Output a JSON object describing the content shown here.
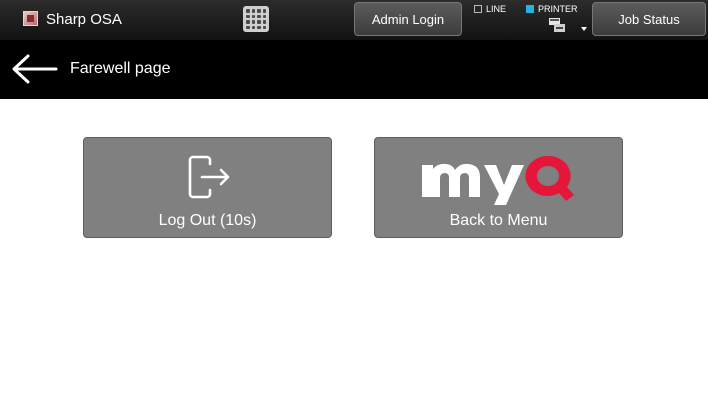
{
  "statusbar": {
    "app_title": "Sharp OSA",
    "admin_login_label": "Admin Login",
    "line_label": "LINE",
    "printer_label": "PRINTER",
    "job_status_label": "Job Status",
    "printer_indicator_color": "#25b4e0"
  },
  "header": {
    "title": "Farewell page"
  },
  "tiles": [
    {
      "label": "Log Out (10s)",
      "icon": "logout-icon"
    },
    {
      "label": "Back to Menu",
      "icon": "myq-logo",
      "logo_text": "myQ",
      "logo_accent_color": "#e4173a"
    }
  ],
  "colors": {
    "tile_background": "#808080",
    "header_background": "#000000"
  }
}
